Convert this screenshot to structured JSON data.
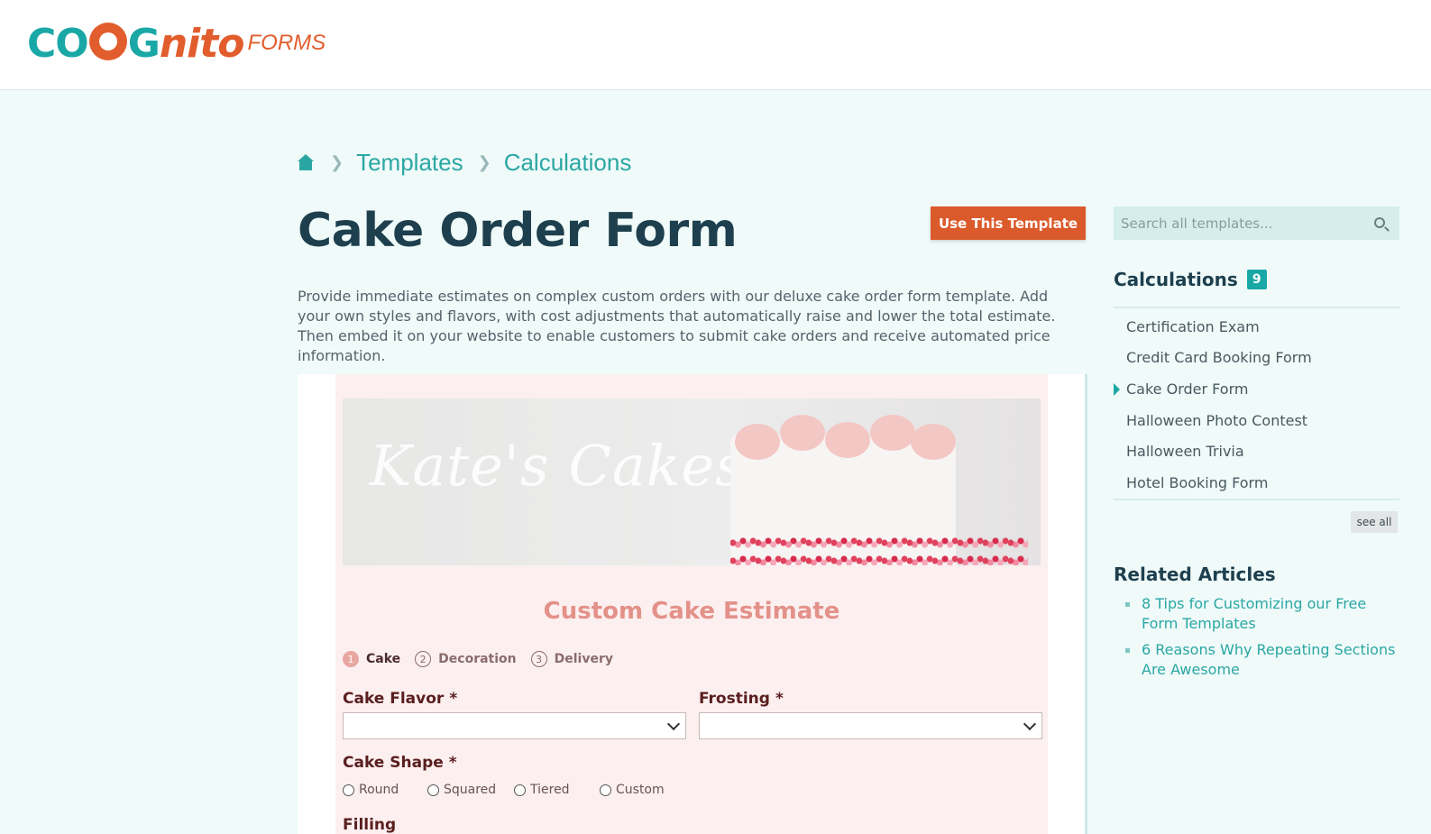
{
  "header": {
    "logo_main_c": "CO",
    "logo_main_g": "G",
    "logo_main_rest": "nito",
    "logo_forms": "FORMS"
  },
  "breadcrumb": {
    "items": [
      "Templates",
      "Calculations"
    ]
  },
  "page": {
    "title": "Cake Order Form",
    "use_button_label": "Use This Template",
    "description": "Provide immediate estimates on complex custom orders with our deluxe cake order form template. Add your own styles and flavors, with cost adjustments that automatically raise and lower the total estimate. Then embed it on your website to enable customers to submit cake orders and receive automated price information."
  },
  "preview": {
    "banner_script": "Kate's Cakes",
    "form_title": "Custom Cake Estimate",
    "steps": [
      {
        "num": "1",
        "label": "Cake"
      },
      {
        "num": "2",
        "label": "Decoration"
      },
      {
        "num": "3",
        "label": "Delivery"
      }
    ],
    "fields": {
      "cake_flavor": "Cake Flavor",
      "frosting": "Frosting",
      "cake_shape": "Cake Shape",
      "filling": "Filling",
      "required_mark": "*"
    },
    "shape_options": [
      "Round",
      "Squared",
      "Tiered",
      "Custom"
    ]
  },
  "sidebar": {
    "search_placeholder": "Search all templates...",
    "category_title": "Calculations",
    "category_count": "9",
    "templates": [
      "Certification Exam",
      "Credit Card Booking Form",
      "Cake Order Form",
      "Halloween Photo Contest",
      "Halloween Trivia",
      "Hotel Booking Form"
    ],
    "current_template": "Cake Order Form",
    "see_all_label": "see all",
    "related_title": "Related Articles",
    "related_articles": [
      "8 Tips for Customizing our Free Form Templates",
      "6 Reasons Why Repeating Sections Are Awesome"
    ]
  },
  "colors": {
    "accent_teal": "#1aa8a6",
    "brand_orange": "#db5a2b",
    "title_navy": "#1e3f4e",
    "form_pink": "#fcefef"
  }
}
